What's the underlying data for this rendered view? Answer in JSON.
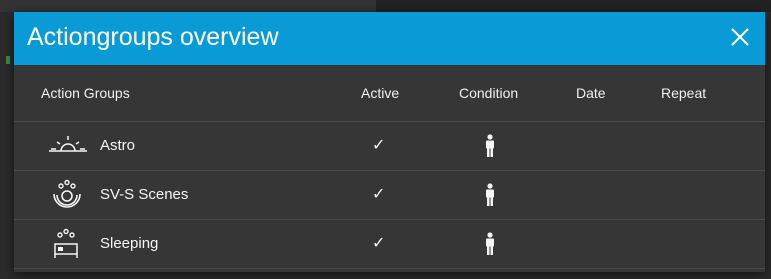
{
  "dialog": {
    "title": "Actiongroups overview",
    "header_color": "#0a9bd6"
  },
  "columns": {
    "action_groups": "Action Groups",
    "active": "Active",
    "condition": "Condition",
    "date": "Date",
    "repeat": "Repeat"
  },
  "rows": [
    {
      "label": "Astro",
      "icon": "sunrise-icon",
      "active": "✓",
      "condition_icon": "person-icon"
    },
    {
      "label": "SV-S Scenes",
      "icon": "scenes-icon",
      "active": "✓",
      "condition_icon": "person-icon"
    },
    {
      "label": "Sleeping",
      "icon": "bed-icon",
      "active": "✓",
      "condition_icon": "person-icon"
    }
  ]
}
